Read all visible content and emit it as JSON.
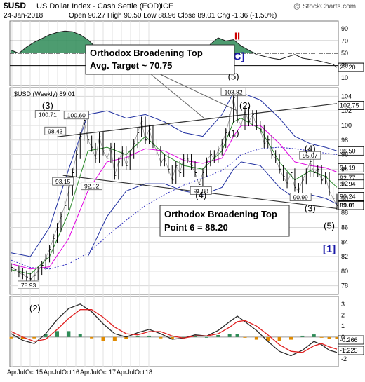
{
  "header": {
    "symbol": "$USD",
    "name": "US Dollar Index - Cash Settle (EOD)",
    "exchange": "ICE",
    "watermark": "@ StockCharts.com",
    "date": "24-Jan-2018",
    "ohlc_text": "Open 90.27  High 90.50  Low 88.96  Close 89.01  Chg -1.36 (-1.50%)",
    "legend": "$USD (Weekly) 89.01"
  },
  "chart_data": [
    {
      "type": "line",
      "panel": "rsi",
      "y_ticks": [
        10,
        30,
        50,
        70,
        90
      ],
      "ylim": [
        0,
        100
      ],
      "reference_lines": [
        30,
        50,
        70
      ],
      "last_value_label": "27.20",
      "x": [
        0,
        4,
        8,
        12,
        16,
        20,
        24,
        28,
        32,
        36,
        40,
        44,
        48,
        52,
        56,
        60,
        64,
        68,
        72,
        76,
        80,
        84,
        88,
        92,
        96,
        100,
        104,
        108,
        112,
        116,
        120,
        124,
        128,
        132,
        136,
        140,
        144,
        148,
        152,
        156,
        160,
        164,
        168,
        170
      ],
      "values": [
        55,
        50,
        60,
        68,
        74,
        80,
        84,
        86,
        85,
        80,
        72,
        60,
        55,
        58,
        50,
        45,
        48,
        52,
        55,
        50,
        45,
        48,
        52,
        58,
        55,
        50,
        65,
        75,
        70,
        72,
        62,
        55,
        48,
        45,
        42,
        40,
        44,
        48,
        42,
        40,
        38,
        35,
        32,
        27.2
      ]
    },
    {
      "type": "line",
      "panel": "price",
      "title": "$USD (Weekly) 89.01",
      "y_ticks": [
        78,
        80,
        82,
        84,
        86,
        88,
        90,
        92,
        94,
        96,
        98,
        100,
        102,
        104
      ],
      "ylim": [
        77,
        105
      ],
      "x_ticks": [
        "Apr",
        "Jul",
        "Oct",
        "15",
        "Apr",
        "Jul",
        "Oct",
        "16",
        "Apr",
        "Jul",
        "Oct",
        "17",
        "Apr",
        "Jul",
        "Oct",
        "18"
      ],
      "series": [
        {
          "name": "$USD",
          "x": [
            0,
            2,
            4,
            6,
            8,
            10,
            12,
            14,
            16,
            18,
            20,
            22,
            24,
            26,
            28,
            30,
            32,
            34,
            36,
            38,
            40,
            42,
            44,
            46,
            48,
            50,
            52,
            54,
            56,
            58,
            60,
            62,
            64,
            66,
            68,
            70,
            72,
            74,
            76,
            78,
            80,
            82,
            84,
            86,
            88,
            90,
            92,
            94,
            96,
            98,
            100,
            102,
            104,
            106,
            108,
            110,
            112,
            114,
            116,
            118,
            120,
            122,
            124,
            126,
            128,
            130,
            132,
            134,
            136,
            138,
            140,
            142,
            144,
            146,
            148,
            150,
            152,
            154,
            156,
            158,
            160,
            162,
            164,
            166,
            168,
            170
          ],
          "values": [
            80.5,
            80.2,
            79.8,
            79.5,
            79.2,
            78.93,
            79.4,
            80.0,
            80.8,
            81.8,
            83.0,
            84.5,
            86.0,
            87.5,
            89.0,
            91.0,
            93.5,
            96.0,
            98.5,
            100.71,
            98.0,
            97.0,
            95.5,
            98.43,
            96.5,
            95.5,
            97.0,
            93.15,
            95.0,
            96.5,
            94.5,
            96.0,
            97.5,
            99.0,
            100.6,
            98.0,
            99.5,
            97.5,
            96.5,
            95.0,
            95.5,
            94.0,
            92.52,
            94.5,
            93.5,
            95.5,
            95.5,
            94.5,
            93.5,
            91.88,
            93.5,
            95.0,
            96.0,
            95.5,
            96.5,
            97.5,
            99.0,
            101.0,
            103.82,
            101.0,
            100.0,
            102.0,
            100.5,
            101.5,
            100.0,
            99.5,
            97.5,
            98.0,
            96.0,
            95.5,
            94.0,
            93.0,
            92.0,
            93.5,
            91.5,
            90.99,
            92.5,
            93.5,
            95.07,
            93.5,
            94.0,
            92.5,
            93.0,
            91.0,
            90.0,
            89.01
          ]
        },
        {
          "name": "fast MA",
          "x": [
            0,
            10,
            20,
            30,
            40,
            50,
            60,
            70,
            80,
            90,
            100,
            110,
            116,
            120,
            130,
            140,
            148,
            156,
            164,
            170
          ],
          "values": [
            80.2,
            79.6,
            82.0,
            88.0,
            96.5,
            97.0,
            96.0,
            98.5,
            96.0,
            94.5,
            94.0,
            96.5,
            100.5,
            101.0,
            99.5,
            95.0,
            92.5,
            93.8,
            93.0,
            91.5
          ]
        },
        {
          "name": "slow MA",
          "x": [
            0,
            10,
            20,
            30,
            40,
            50,
            60,
            70,
            80,
            90,
            100,
            110,
            116,
            120,
            130,
            140,
            148,
            156,
            164,
            170
          ],
          "values": [
            81.0,
            80.3,
            80.6,
            84.5,
            91.0,
            95.0,
            95.6,
            96.8,
            96.5,
            95.2,
            94.8,
            95.5,
            98.5,
            100.0,
            100.0,
            97.5,
            95.0,
            94.5,
            94.2,
            93.6
          ]
        },
        {
          "name": "long MA",
          "x": [
            0,
            10,
            20,
            30,
            40,
            50,
            60,
            70,
            80,
            90,
            100,
            110,
            116,
            120,
            130,
            140,
            148,
            156,
            164,
            170
          ],
          "values": [
            81.5,
            80.5,
            80.3,
            81.0,
            82.5,
            84.8,
            87.0,
            89.0,
            90.5,
            91.8,
            92.8,
            93.8,
            95.0,
            96.0,
            96.8,
            97.0,
            96.8,
            96.5,
            96.2,
            96.0
          ]
        },
        {
          "name": "upper band",
          "x": [
            0,
            10,
            20,
            30,
            40,
            50,
            60,
            70,
            80,
            90,
            100,
            110,
            116,
            120,
            130,
            140,
            148,
            156,
            164,
            170
          ],
          "values": [
            82.5,
            82.0,
            86.0,
            94.0,
            101.5,
            102.0,
            101.0,
            101.5,
            100.5,
            99.0,
            98.5,
            101.5,
            104.5,
            104.5,
            103.5,
            101.0,
            98.5,
            97.5,
            97.0,
            96.5
          ]
        },
        {
          "name": "lower band",
          "x": [
            40,
            50,
            60,
            70,
            80,
            90,
            100,
            110,
            116,
            120,
            130,
            140,
            148,
            156,
            164,
            170
          ],
          "values": [
            82.0,
            87.5,
            91.0,
            92.0,
            92.0,
            91.0,
            90.5,
            91.5,
            94.0,
            95.0,
            94.5,
            91.5,
            90.0,
            90.5,
            90.0,
            89.2
          ]
        }
      ],
      "trendlines": [
        {
          "name": "upper broadening line",
          "x": [
            24,
            170
          ],
          "values": [
            98.43,
            103.0
          ]
        },
        {
          "name": "lower broadening line",
          "x": [
            27,
            170
          ],
          "values": [
            93.15,
            88.6
          ]
        }
      ],
      "value_labels": [
        {
          "x": 9,
          "y": 78.93,
          "text": "78.93"
        },
        {
          "x": 19,
          "y": 100.71,
          "text": "100.71"
        },
        {
          "x": 23,
          "y": 98.43,
          "text": "98.43"
        },
        {
          "x": 27,
          "y": 93.15,
          "text": "93.15"
        },
        {
          "x": 42,
          "y": 92.52,
          "text": "92.52"
        },
        {
          "x": 34,
          "y": 100.6,
          "text": "100.60"
        },
        {
          "x": 99,
          "y": 91.88,
          "text": "91.88"
        },
        {
          "x": 116,
          "y": 103.82,
          "text": "103.82"
        },
        {
          "x": 151,
          "y": 90.99,
          "text": "90.99"
        },
        {
          "x": 156,
          "y": 95.07,
          "text": "95.07"
        }
      ],
      "right_labels": [
        "102.75",
        "96.50",
        "94.19",
        "92.77",
        "91.94",
        "90.24",
        "89.01"
      ],
      "right_label_values": [
        102.75,
        96.5,
        94.19,
        92.77,
        91.94,
        90.24,
        89.01
      ],
      "wave_labels": [
        {
          "x": 19,
          "y": 102.3,
          "text": "(3)",
          "color": "#000000"
        },
        {
          "x": 99,
          "y": 90.0,
          "text": "(4)",
          "color": "#000000"
        },
        {
          "x": 116,
          "y": 106.3,
          "text": "(5)",
          "color": "#000000"
        },
        {
          "x": 122,
          "y": 102.3,
          "text": "(2)",
          "color": "#000000"
        },
        {
          "x": 116,
          "y": 98.5,
          "text": "(1)",
          "color": "#000000"
        },
        {
          "x": 156,
          "y": 88.2,
          "text": "(3)",
          "color": "#000000"
        },
        {
          "x": 156,
          "y": 96.4,
          "text": "(4)",
          "color": "#000000"
        },
        {
          "x": 166,
          "y": 85.8,
          "text": "(5)",
          "color": "#000000"
        },
        {
          "x": 166,
          "y": 82.6,
          "text": "[1]",
          "color": "#1a1aa8"
        },
        {
          "x": 118,
          "y": 109.0,
          "text": "[C]",
          "color": "#1a1aa8"
        },
        {
          "x": 118,
          "y": 111.8,
          "text": "II",
          "color": "#cc0000"
        }
      ],
      "annotations": [
        "Orthodox Broadening Top",
        "Avg. Target ~ 70.75",
        "Orthodox Broadening Top",
        "Point 6  = 88.20"
      ]
    },
    {
      "type": "line",
      "panel": "macd",
      "y_ticks": [
        3,
        2,
        1,
        0,
        -1,
        -2
      ],
      "ylim": [
        -2.5,
        3.5
      ],
      "last_value_labels": [
        "-0.266",
        "-1.225"
      ],
      "wave_label": "(2)",
      "series": [
        {
          "name": "macd",
          "x": [
            0,
            6,
            12,
            18,
            24,
            30,
            36,
            42,
            48,
            54,
            60,
            66,
            72,
            78,
            84,
            90,
            96,
            102,
            108,
            114,
            118,
            122,
            128,
            134,
            140,
            146,
            152,
            158,
            162,
            166,
            170
          ],
          "values": [
            0.3,
            -0.3,
            -0.6,
            0.3,
            1.6,
            2.6,
            3.0,
            2.3,
            1.2,
            0.3,
            0.0,
            0.4,
            0.7,
            0.3,
            -0.2,
            -0.1,
            0.2,
            0.1,
            0.6,
            1.4,
            1.9,
            1.4,
            0.6,
            -0.4,
            -1.3,
            -1.7,
            -1.2,
            -0.4,
            -0.7,
            -1.2,
            -1.4
          ]
        },
        {
          "name": "signal",
          "x": [
            0,
            6,
            12,
            18,
            24,
            30,
            36,
            42,
            48,
            54,
            60,
            66,
            72,
            78,
            84,
            90,
            96,
            102,
            108,
            114,
            118,
            122,
            128,
            134,
            140,
            146,
            152,
            158,
            162,
            166,
            170
          ],
          "values": [
            0.5,
            0.0,
            -0.4,
            -0.2,
            0.7,
            1.7,
            2.5,
            2.5,
            1.8,
            0.9,
            0.3,
            0.2,
            0.5,
            0.5,
            0.1,
            -0.1,
            0.1,
            0.1,
            0.3,
            0.9,
            1.4,
            1.5,
            1.0,
            0.2,
            -0.7,
            -1.3,
            -1.4,
            -0.8,
            -0.6,
            -0.9,
            -1.1
          ]
        }
      ],
      "histogram": {
        "x": [
          0,
          6,
          12,
          18,
          24,
          30,
          36,
          42,
          48,
          54,
          60,
          66,
          72,
          78,
          84,
          90,
          96,
          102,
          108,
          114,
          118,
          122,
          128,
          134,
          140,
          146,
          152,
          158,
          162,
          166,
          170
        ],
        "values": [
          -0.2,
          -0.3,
          -0.2,
          0.5,
          0.9,
          0.9,
          0.5,
          -0.2,
          -0.6,
          -0.6,
          -0.3,
          0.2,
          0.2,
          -0.2,
          -0.3,
          0.0,
          0.1,
          0.0,
          0.3,
          0.5,
          0.5,
          -0.1,
          -0.4,
          -0.6,
          -0.6,
          -0.4,
          0.2,
          0.4,
          -0.1,
          -0.3,
          -0.3
        ]
      }
    }
  ],
  "colors": {
    "price": "#000000",
    "fast_ma": "#2a8a2a",
    "slow_ma": "#e000e0",
    "long_ma": "#3030c0",
    "band": "#1f2fa0",
    "trend": "#333333",
    "rsi_fill": "#2e8b57",
    "hist_pos": "#2e8b57",
    "hist_neg": "#e08a00",
    "macd": "#2b2b2b",
    "signal": "#e02020",
    "blue_label": "#1a1aa8",
    "red_label": "#cc0000"
  }
}
